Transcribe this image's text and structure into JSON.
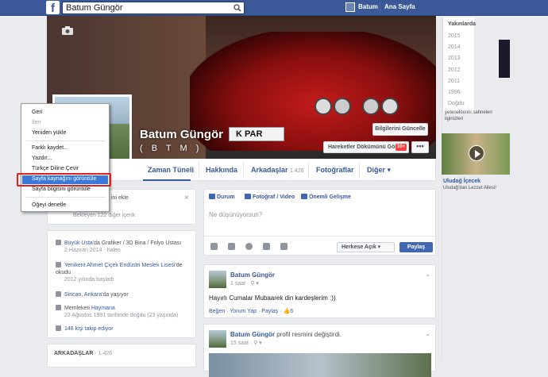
{
  "topbar": {
    "logo": "f",
    "search_value": "Batum Güngör",
    "user_name": "Batum",
    "home_label": "Ana Sayfa"
  },
  "profile": {
    "name": "Batum Güngör",
    "subtitle": "( B T M )",
    "plate_text": "K   PAR",
    "update_button": "Bilgilerini Güncelle",
    "activity_button": "Hareketler Dökümünü Gör",
    "activity_badge": "10+",
    "more_button": "•••"
  },
  "tabs": [
    {
      "label": "Zaman Tüneli"
    },
    {
      "label": "Hakkında"
    },
    {
      "label": "Arkadaşlar",
      "count": "1.426"
    },
    {
      "label": "Fotoğraflar"
    },
    {
      "label": "Diğer ▾"
    }
  ],
  "people_card": {
    "title_fragment": "ini ekle",
    "pending": "Bekleyen 122 diğer içerik"
  },
  "about": {
    "work": {
      "prefix": "Büyük Usta",
      "suffix": "'da Grafiker / 3D Bina / Folyo Ustası",
      "date": "2 Haziran 2014 - halen"
    },
    "school": {
      "prefix": "Yenikent Ahmet Çiçek Endüstri Meslek Lisesi",
      "suffix": "'de okudu",
      "date": "2012 yılında başladı"
    },
    "lives": {
      "prefix": "Sincan, Ankara",
      "suffix": "'da yaşıyor"
    },
    "hometown": {
      "prefix": "Memleketi ",
      "place": "Haymana",
      "date": "23 Ağustos 1991 tarihinde doğdu (23 yaşında)"
    },
    "followers": "148 kişi takip ediyor"
  },
  "friends_card": {
    "title": "ARKADAŞLAR",
    "count": "· 1.426"
  },
  "composer": {
    "tab_status": "Durum",
    "tab_photo": "Fotoğraf / Video",
    "tab_event": "Önemli Gelişme",
    "placeholder": "Ne düşünüyorsun?",
    "audience": "Herkese Açık ▾",
    "share": "Paylaş"
  },
  "posts": [
    {
      "author": "Batum Güngör",
      "extra": "",
      "meta": "1 saat · ⚲ ▾",
      "text": "Hayırlı Cumalar Mubaarek din kardeşlerim :))",
      "actions": "Beğen · Yorum Yap · Paylaş · 👍6"
    },
    {
      "author": "Batum Güngör",
      "extra": " profil resmini değiştirdi.",
      "meta": "15 saat · ⚲ ▾"
    }
  ],
  "years": {
    "header": "Yakınlarda",
    "list": [
      "2015",
      "2014",
      "2013",
      "2012",
      "2011",
      "1996",
      "Doğdu"
    ]
  },
  "ads": {
    "text1": "yeteneklerini sahneleri ilginizleri",
    "title2": "Uludağ İçecek",
    "sub2": "Uludağ'dan Lezzet Ailesi!"
  },
  "context_menu": {
    "items": [
      {
        "label": "Geri",
        "disabled": false
      },
      {
        "label": "İleri",
        "disabled": true
      },
      {
        "label": "Yeniden yükle",
        "disabled": false
      },
      {
        "label": "Farklı kaydet...",
        "disabled": false
      },
      {
        "label": "Yazdır...",
        "disabled": false
      },
      {
        "label": "Türkçe Diline Çevir",
        "disabled": false
      },
      {
        "label": "Sayfa kaynağını görüntüle",
        "disabled": false
      },
      {
        "label": "Sayfa bilgisini görüntüle",
        "disabled": false
      },
      {
        "label": "Öğeyi denetle",
        "disabled": false
      }
    ]
  },
  "colors": {
    "brand": "#3b5998",
    "link": "#365899",
    "menu_highlight": "#3879d9",
    "annotation_box": "#e02020"
  }
}
